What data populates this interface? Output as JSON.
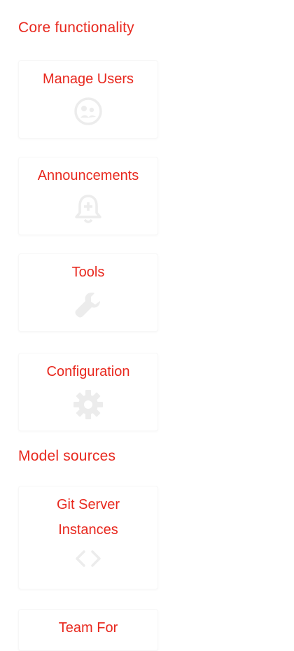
{
  "sections": {
    "core": {
      "title": "Core functionality"
    },
    "model": {
      "title": "Model sources"
    }
  },
  "cards": {
    "manage_users": {
      "label": "Manage Users",
      "icon": "users-face-icon"
    },
    "announcements": {
      "label": "Announcements",
      "icon": "bell-plus-icon"
    },
    "tools": {
      "label": "Tools",
      "icon": "wrench-icon"
    },
    "configuration": {
      "label": "Configuration",
      "icon": "gear-icon"
    },
    "git_server": {
      "label_line1": "Git Server",
      "label_line2": "Instances",
      "icon": "code-brackets-icon"
    },
    "team_for": {
      "label": "Team For"
    }
  },
  "colors": {
    "accent": "#e8281e",
    "icon": "#ececec",
    "background": "#ffffff"
  }
}
